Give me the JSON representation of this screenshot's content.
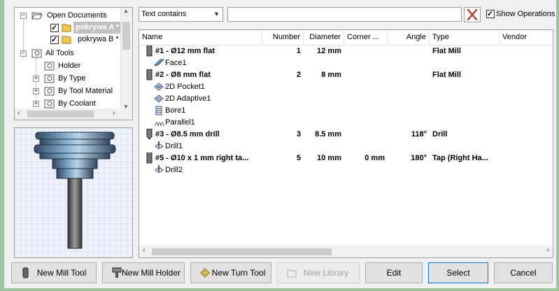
{
  "tree": {
    "items": [
      {
        "label": "Open Documents",
        "expander": "-"
      },
      {
        "label": "pokrywa A *",
        "checked": true,
        "selected": true
      },
      {
        "label": "pokrywa B *",
        "checked": true
      },
      {
        "label": "All Tools",
        "expander": "-"
      },
      {
        "label": "Holder"
      },
      {
        "label": "By Type",
        "expander": "+"
      },
      {
        "label": "By Tool Material",
        "expander": "+"
      },
      {
        "label": "By Coolant",
        "expander": "+"
      }
    ]
  },
  "filter": {
    "mode": "Text contains",
    "search_value": "",
    "show_operations_label": "Show Operations",
    "show_operations_checked": true
  },
  "table": {
    "columns": [
      "Name",
      "Number",
      "Diameter",
      "Corner ...",
      "Angle",
      "Type",
      "Vendor"
    ],
    "rows": [
      {
        "kind": "tool",
        "icon": "flat-mill-icon",
        "name": "#1 - Ø12 mm flat",
        "number": "1",
        "diameter": "12 mm",
        "corner": "",
        "angle": "",
        "type": "Flat Mill",
        "vendor": ""
      },
      {
        "kind": "op",
        "icon": "face-op-icon",
        "name": "Face1"
      },
      {
        "kind": "tool",
        "icon": "flat-mill-icon",
        "name": "#2 - Ø8 mm flat",
        "number": "2",
        "diameter": "8 mm",
        "corner": "",
        "angle": "",
        "type": "Flat Mill",
        "vendor": ""
      },
      {
        "kind": "op",
        "icon": "pocket-op-icon",
        "name": "2D Pocket1"
      },
      {
        "kind": "op",
        "icon": "adaptive-op-icon",
        "name": "2D Adaptive1"
      },
      {
        "kind": "op",
        "icon": "bore-op-icon",
        "name": "Bore1"
      },
      {
        "kind": "op",
        "icon": "parallel-op-icon",
        "name": "Parallel1"
      },
      {
        "kind": "tool",
        "icon": "drill-tool-icon",
        "name": "#3 - Ø8.5 mm drill",
        "number": "3",
        "diameter": "8.5 mm",
        "corner": "",
        "angle": "118°",
        "type": "Drill",
        "vendor": ""
      },
      {
        "kind": "op",
        "icon": "drill-op-icon",
        "name": "Drill1"
      },
      {
        "kind": "tool",
        "icon": "tap-tool-icon",
        "name": "#5 - Ø10 x 1 mm right ta...",
        "number": "5",
        "diameter": "10 mm",
        "corner": "0 mm",
        "angle": "180°",
        "type": "Tap (Right Ha...",
        "vendor": ""
      },
      {
        "kind": "op",
        "icon": "drill-op-icon",
        "name": "Drill2"
      }
    ]
  },
  "buttons": {
    "new_mill_tool": "New Mill Tool",
    "new_mill_holder": "New Mill Holder",
    "new_turn_tool": "New Turn Tool",
    "new_library": "New Library",
    "edit": "Edit",
    "select": "Select",
    "cancel": "Cancel"
  },
  "colors": {
    "accent": "#0078d7",
    "clear_red": "#c0392b",
    "folder": "#f2c94c"
  }
}
